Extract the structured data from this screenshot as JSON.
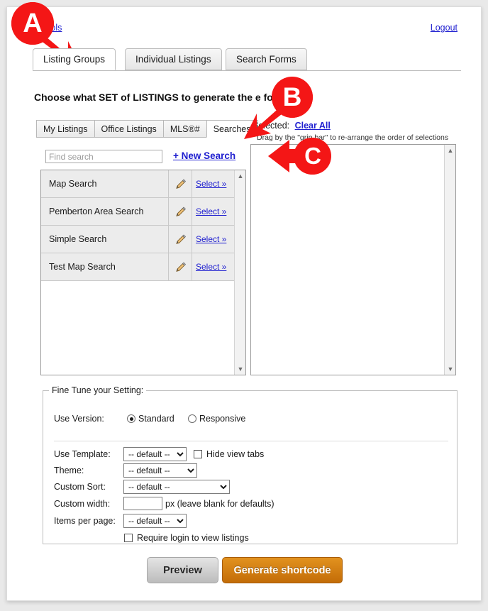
{
  "header": {
    "left_link": "g Tools",
    "logout_link": "Logout"
  },
  "main_tabs": [
    {
      "label": "Listing Groups",
      "active": true
    },
    {
      "label": "Individual Listings",
      "active": false
    },
    {
      "label": "Search Forms",
      "active": false
    }
  ],
  "heading": "Choose what SET of LISTINGS to generate the   e for:",
  "sub_tabs": [
    {
      "label": "My Listings",
      "active": false
    },
    {
      "label": "Office Listings",
      "active": false
    },
    {
      "label": "MLS®#",
      "active": false
    },
    {
      "label": "Searches",
      "active": true
    }
  ],
  "selection": {
    "selected_label": "Selected:",
    "clear_all": "Clear All",
    "hint": "Drag by the \"grip bar\" to re-arrange the order of selections"
  },
  "search": {
    "placeholder": "Find search",
    "value": "",
    "new_search_link": "+ New Search"
  },
  "list": {
    "select_label": "Select »",
    "rows": [
      {
        "name": "Map Search"
      },
      {
        "name": "Pemberton Area Search"
      },
      {
        "name": "Simple Search"
      },
      {
        "name": "Test Map Search"
      }
    ]
  },
  "fine_tune": {
    "legend": "Fine Tune your Setting:",
    "use_version": {
      "label": "Use Version:",
      "options": [
        {
          "label": "Standard",
          "selected": true
        },
        {
          "label": "Responsive",
          "selected": false
        }
      ]
    },
    "use_template": {
      "label": "Use Template:",
      "value": "-- default --",
      "options": [
        "-- default --"
      ]
    },
    "hide_view_tabs": {
      "label": "Hide view tabs",
      "checked": false
    },
    "theme": {
      "label": "Theme:",
      "value": "-- default --",
      "options": [
        "-- default --"
      ]
    },
    "custom_sort": {
      "label": "Custom Sort:",
      "value": "-- default --",
      "options": [
        "-- default --"
      ]
    },
    "custom_width": {
      "label": "Custom width:",
      "value": "",
      "suffix": "px (leave blank for defaults)"
    },
    "items_per_page": {
      "label": "Items per page:",
      "value": "-- default --",
      "options": [
        "-- default --"
      ]
    },
    "require_login": {
      "label": "Require login to view listings",
      "checked": false
    }
  },
  "buttons": {
    "preview": "Preview",
    "generate": "Generate shortcode"
  },
  "annotations": [
    {
      "id": "A",
      "label": "A"
    },
    {
      "id": "B",
      "label": "B"
    },
    {
      "id": "C",
      "label": "C"
    }
  ],
  "colors": {
    "accent_link": "#2020d0",
    "annotation_red": "#f41616",
    "generate_orange": "#d07f14",
    "page_bg": "#e9e9e9"
  }
}
